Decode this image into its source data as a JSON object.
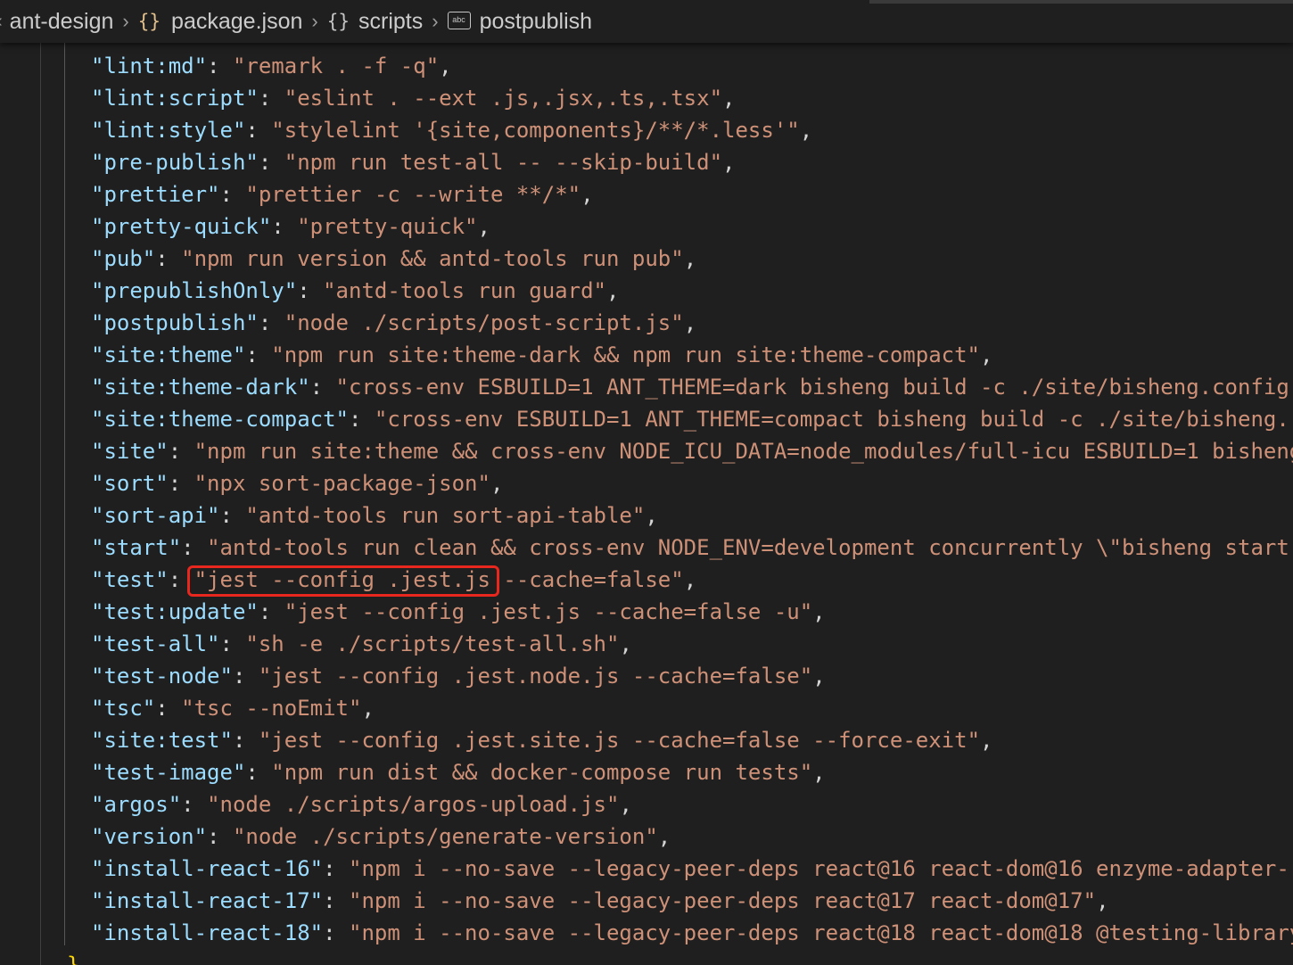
{
  "breadcrumb": {
    "project": "ant-design",
    "file": "package.json",
    "section": "scripts",
    "item": "postpublish",
    "separator": "›",
    "icons": [
      "chevron-left-icon",
      "json-braces-icon",
      "object-braces-icon",
      "string-abc-icon"
    ],
    "colors": {
      "file_icon": "#e2c08d",
      "section_icon": "#c5c5c5"
    }
  },
  "editor": {
    "colors": {
      "background": "#1f1f1f",
      "key": "#9cdcfe",
      "string": "#ce9178",
      "punctuation": "#d4d4d4",
      "highlight_box": "#e8271f"
    },
    "scripts": [
      {
        "key": "lint:md",
        "value": "remark . -f -q",
        "trail": ","
      },
      {
        "key": "lint:script",
        "value": "eslint . --ext .js,.jsx,.ts,.tsx",
        "trail": ","
      },
      {
        "key": "lint:style",
        "value": "stylelint '{site,components}/**/*.less'",
        "trail": ","
      },
      {
        "key": "pre-publish",
        "value": "npm run test-all -- --skip-build",
        "trail": ","
      },
      {
        "key": "prettier",
        "value": "prettier -c --write **/*",
        "trail": ","
      },
      {
        "key": "pretty-quick",
        "value": "pretty-quick",
        "trail": ","
      },
      {
        "key": "pub",
        "value": "npm run version && antd-tools run pub",
        "trail": ","
      },
      {
        "key": "prepublishOnly",
        "value": "antd-tools run guard",
        "trail": ","
      },
      {
        "key": "postpublish",
        "value": "node ./scripts/post-script.js",
        "trail": ","
      },
      {
        "key": "site:theme",
        "value": "npm run site:theme-dark && npm run site:theme-compact",
        "trail": ","
      },
      {
        "key": "site:theme-dark",
        "value": "cross-env ESBUILD=1 ANT_THEME=dark bisheng build -c ./site/bisheng.config",
        "trail": ""
      },
      {
        "key": "site:theme-compact",
        "value": "cross-env ESBUILD=1 ANT_THEME=compact bisheng build -c ./site/bisheng.",
        "trail": ""
      },
      {
        "key": "site",
        "value": "npm run site:theme && cross-env NODE_ICU_DATA=node_modules/full-icu ESBUILD=1 bisheng",
        "trail": ""
      },
      {
        "key": "sort",
        "value": "npx sort-package-json",
        "trail": ","
      },
      {
        "key": "sort-api",
        "value": "antd-tools run sort-api-table",
        "trail": ","
      },
      {
        "key": "start",
        "value": "antd-tools run clean && cross-env NODE_ENV=development concurrently \\\"bisheng start",
        "trail": ""
      },
      {
        "key": "test",
        "value": "jest --config .jest.js --cache=false",
        "trail": ","
      },
      {
        "key": "test:update",
        "value": "jest --config .jest.js --cache=false -u",
        "trail": ","
      },
      {
        "key": "test-all",
        "value": "sh -e ./scripts/test-all.sh",
        "trail": ","
      },
      {
        "key": "test-node",
        "value": "jest --config .jest.node.js --cache=false",
        "trail": ","
      },
      {
        "key": "tsc",
        "value": "tsc --noEmit",
        "trail": ","
      },
      {
        "key": "site:test",
        "value": "jest --config .jest.site.js --cache=false --force-exit",
        "trail": ","
      },
      {
        "key": "test-image",
        "value": "npm run dist && docker-compose run tests",
        "trail": ","
      },
      {
        "key": "argos",
        "value": "node ./scripts/argos-upload.js",
        "trail": ","
      },
      {
        "key": "version",
        "value": "node ./scripts/generate-version",
        "trail": ","
      },
      {
        "key": "install-react-16",
        "value": "npm i --no-save --legacy-peer-deps react@16 react-dom@16 enzyme-adapter-r",
        "trail": ""
      },
      {
        "key": "install-react-17",
        "value": "npm i --no-save --legacy-peer-deps react@17 react-dom@17",
        "trail": ","
      },
      {
        "key": "install-react-18",
        "value": "npm i --no-save --legacy-peer-deps react@18 react-dom@18 @testing-library",
        "trail": ""
      }
    ],
    "highlighted_text": "\"jest --config .jest.js",
    "closing_brace": "}"
  }
}
